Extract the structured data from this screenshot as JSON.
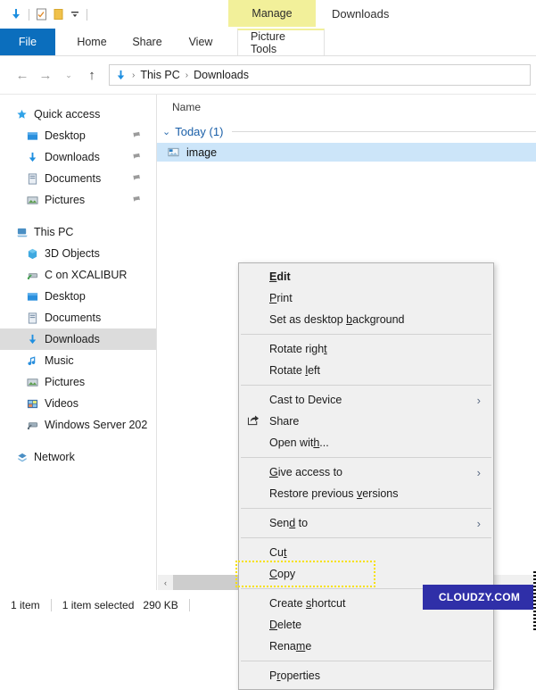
{
  "window": {
    "title": "Downloads",
    "manage_tab": "Manage"
  },
  "quick_access_toolbar": {
    "items": [
      {
        "name": "downloads-icon",
        "glyph": "⬇"
      },
      {
        "name": "properties-icon",
        "glyph": "☑"
      },
      {
        "name": "new-folder-icon",
        "glyph": "▮"
      },
      {
        "name": "customize-qat-icon",
        "glyph": "⌄"
      }
    ]
  },
  "ribbon": {
    "tabs": [
      {
        "label": "File",
        "selected": true
      },
      {
        "label": "Home",
        "selected": false
      },
      {
        "label": "Share",
        "selected": false
      },
      {
        "label": "View",
        "selected": false
      },
      {
        "label": "Picture Tools",
        "selected": false
      }
    ]
  },
  "address_bar": {
    "back": "←",
    "forward": "→",
    "recent": "⌄",
    "up": "↑",
    "crumbs": [
      "This PC",
      "Downloads"
    ],
    "separator": "›",
    "location_icon": "⬇"
  },
  "sidebar": {
    "items": [
      {
        "label": "Quick access",
        "icon": "star-icon",
        "glyph": "★",
        "indent": false,
        "pinned": false,
        "selected": false
      },
      {
        "label": "Desktop",
        "icon": "desktop-icon",
        "glyph": "■",
        "indent": true,
        "pinned": true,
        "selected": false
      },
      {
        "label": "Downloads",
        "icon": "downloads-icon",
        "glyph": "⬇",
        "indent": true,
        "pinned": true,
        "selected": false
      },
      {
        "label": "Documents",
        "icon": "documents-icon",
        "glyph": "▤",
        "indent": true,
        "pinned": true,
        "selected": false
      },
      {
        "label": "Pictures",
        "icon": "pictures-icon",
        "glyph": "▦",
        "indent": true,
        "pinned": true,
        "selected": false
      },
      {
        "label": "This PC",
        "icon": "this-pc-icon",
        "glyph": "▰",
        "indent": false,
        "pinned": false,
        "selected": false
      },
      {
        "label": "3D Objects",
        "icon": "3d-objects-icon",
        "glyph": "▧",
        "indent": true,
        "pinned": false,
        "selected": false
      },
      {
        "label": "C on XCALIBUR",
        "icon": "network-drive-icon",
        "glyph": "▲",
        "indent": true,
        "pinned": false,
        "selected": false
      },
      {
        "label": "Desktop",
        "icon": "desktop-icon",
        "glyph": "■",
        "indent": true,
        "pinned": false,
        "selected": false
      },
      {
        "label": "Documents",
        "icon": "documents-icon",
        "glyph": "▤",
        "indent": true,
        "pinned": false,
        "selected": false
      },
      {
        "label": "Downloads",
        "icon": "downloads-icon",
        "glyph": "⬇",
        "indent": true,
        "pinned": false,
        "selected": true
      },
      {
        "label": "Music",
        "icon": "music-icon",
        "glyph": "♪",
        "indent": true,
        "pinned": false,
        "selected": false
      },
      {
        "label": "Pictures",
        "icon": "pictures-icon",
        "glyph": "▦",
        "indent": true,
        "pinned": false,
        "selected": false
      },
      {
        "label": "Videos",
        "icon": "videos-icon",
        "glyph": "▨",
        "indent": true,
        "pinned": false,
        "selected": false
      },
      {
        "label": "Windows Server 202",
        "icon": "drive-icon",
        "glyph": "▰",
        "indent": true,
        "pinned": false,
        "selected": false
      },
      {
        "label": "Network",
        "icon": "network-icon",
        "glyph": "❖",
        "indent": false,
        "pinned": false,
        "selected": false
      }
    ],
    "pin_glyph": "📌"
  },
  "file_list": {
    "column_header": "Name",
    "group": {
      "label": "Today (1)",
      "chevron": "⌄"
    },
    "rows": [
      {
        "name": "image",
        "icon": "image-file-icon",
        "selected": true
      }
    ]
  },
  "context_menu": {
    "items": [
      {
        "label": "Edit",
        "accel": "E",
        "bold": true,
        "submenu": false,
        "icon": null,
        "highlighted": false
      },
      {
        "label": "Print",
        "accel": "P",
        "bold": false,
        "submenu": false,
        "icon": null,
        "highlighted": false
      },
      {
        "label": "Set as desktop background",
        "accel": "b",
        "bold": false,
        "submenu": false,
        "icon": null,
        "highlighted": false
      },
      {
        "separator": true
      },
      {
        "label": "Rotate right",
        "accel": "t",
        "bold": false,
        "submenu": false,
        "icon": null,
        "highlighted": false
      },
      {
        "label": "Rotate left",
        "accel": "l",
        "bold": false,
        "submenu": false,
        "icon": null,
        "highlighted": false
      },
      {
        "separator": true
      },
      {
        "label": "Cast to Device",
        "accel": null,
        "bold": false,
        "submenu": true,
        "icon": null,
        "highlighted": false
      },
      {
        "label": "Share",
        "accel": null,
        "bold": false,
        "submenu": false,
        "icon": "share-icon",
        "icon_glyph": "↪",
        "highlighted": false
      },
      {
        "label": "Open with...",
        "accel": "h",
        "bold": false,
        "submenu": false,
        "icon": null,
        "highlighted": false
      },
      {
        "separator": true
      },
      {
        "label": "Give access to",
        "accel": "G",
        "bold": false,
        "submenu": true,
        "icon": null,
        "highlighted": false
      },
      {
        "label": "Restore previous versions",
        "accel": "v",
        "bold": false,
        "submenu": false,
        "icon": null,
        "highlighted": false
      },
      {
        "separator": true
      },
      {
        "label": "Send to",
        "accel": "d",
        "bold": false,
        "submenu": true,
        "icon": null,
        "highlighted": false
      },
      {
        "separator": true
      },
      {
        "label": "Cut",
        "accel": "t",
        "bold": false,
        "submenu": false,
        "icon": null,
        "highlighted": false
      },
      {
        "label": "Copy",
        "accel": "C",
        "bold": false,
        "submenu": false,
        "icon": null,
        "highlighted": true
      },
      {
        "separator": true
      },
      {
        "label": "Create shortcut",
        "accel": "s",
        "bold": false,
        "submenu": false,
        "icon": null,
        "highlighted": false
      },
      {
        "label": "Delete",
        "accel": "D",
        "bold": false,
        "submenu": false,
        "icon": null,
        "highlighted": false
      },
      {
        "label": "Rename",
        "accel": "m",
        "bold": false,
        "submenu": false,
        "icon": null,
        "highlighted": false
      },
      {
        "separator": true
      },
      {
        "label": "Properties",
        "accel": "r",
        "bold": false,
        "submenu": false,
        "icon": null,
        "highlighted": false
      }
    ],
    "submenu_arrow": "›",
    "highlight_color": "#f7e100"
  },
  "scrollbar": {
    "left_arrow": "‹"
  },
  "status_bar": {
    "item_count": "1 item",
    "selection": "1 item selected",
    "size": "290 KB"
  },
  "watermark": {
    "text": "CLOUDZY.COM",
    "color": "#2f2fa8"
  }
}
